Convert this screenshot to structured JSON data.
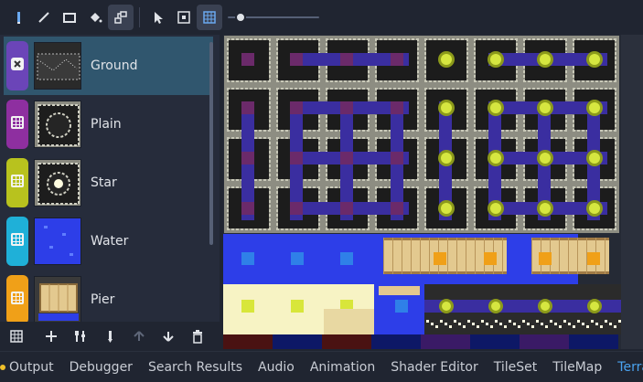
{
  "toolbar": {
    "tools": [
      {
        "name": "paint-pencil-icon",
        "active": false
      },
      {
        "name": "line-icon",
        "active": false
      },
      {
        "name": "rect-icon",
        "active": false
      },
      {
        "name": "bucket-icon",
        "active": false
      },
      {
        "name": "terrain-connect-icon",
        "active": true
      },
      {
        "name": "pointer-icon",
        "active": false
      },
      {
        "name": "picker-icon",
        "active": false
      },
      {
        "name": "grid-toggle-icon",
        "active": true
      }
    ],
    "zoom_level": 0.1
  },
  "terrains": [
    {
      "label": "Ground",
      "color": "#6b45b8",
      "selected": true,
      "kind": "ground"
    },
    {
      "label": "Plain",
      "color": "#8e2fa0",
      "selected": false,
      "kind": "plain"
    },
    {
      "label": "Star",
      "color": "#b8c21e",
      "selected": false,
      "kind": "star"
    },
    {
      "label": "Water",
      "color": "#1fb0d8",
      "selected": false,
      "kind": "water"
    },
    {
      "label": "Pier",
      "color": "#f0a018",
      "selected": false,
      "kind": "pier"
    }
  ],
  "panel_toolbar": {
    "icons": [
      "terrain-grid-icon",
      "add-icon",
      "tools-icon",
      "paint-icon",
      "move-up-icon",
      "move-down-icon",
      "remove-icon"
    ]
  },
  "bottom_tabs": [
    {
      "label": "Output",
      "active": false,
      "dot": true
    },
    {
      "label": "Debugger",
      "active": false
    },
    {
      "label": "Search Results",
      "active": false
    },
    {
      "label": "Audio",
      "active": false
    },
    {
      "label": "Animation",
      "active": false
    },
    {
      "label": "Shader Editor",
      "active": false
    },
    {
      "label": "TileSet",
      "active": false
    },
    {
      "label": "TileMap",
      "active": false
    },
    {
      "label": "Terrain",
      "active": true
    }
  ],
  "colors": {
    "accent": "#4aa3f0",
    "selection": "#30566e",
    "panel": "#262c3b",
    "background": "#202531"
  }
}
